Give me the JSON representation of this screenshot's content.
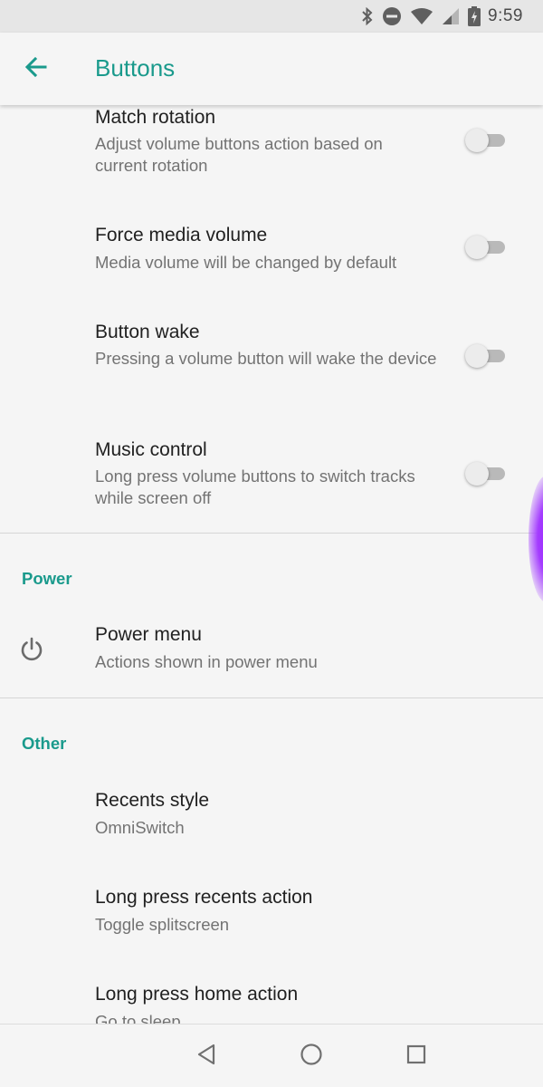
{
  "status_bar": {
    "time": "9:59",
    "icons": [
      "bluetooth-icon",
      "do-not-disturb-icon",
      "wifi-icon",
      "cell-signal-icon",
      "battery-charging-icon"
    ]
  },
  "app_bar": {
    "title": "Buttons",
    "back_icon": "arrow-back-icon"
  },
  "volume_settings": [
    {
      "title": "Match rotation",
      "summary": "Adjust volume buttons action based on current rotation",
      "enabled": false
    },
    {
      "title": "Force media volume",
      "summary": "Media volume will be changed by default",
      "enabled": false
    },
    {
      "title": "Button wake",
      "summary": "Pressing a volume button will wake the device",
      "enabled": false
    },
    {
      "title": "Music control",
      "summary": "Long press volume buttons to switch tracks while screen off",
      "enabled": false
    }
  ],
  "power_section": {
    "header": "Power",
    "item": {
      "title": "Power menu",
      "summary": "Actions shown in power menu",
      "icon": "power-icon"
    }
  },
  "other_section": {
    "header": "Other",
    "items": [
      {
        "title": "Recents style",
        "summary": "OmniSwitch"
      },
      {
        "title": "Long press recents action",
        "summary": "Toggle splitscreen"
      },
      {
        "title": "Long press home action",
        "summary": "Go to sleep"
      }
    ]
  },
  "nav_bar": {
    "buttons": [
      "back-triangle-icon",
      "home-circle-icon",
      "recents-square-icon"
    ]
  },
  "colors": {
    "accent": "#1a9a8c",
    "edge_glow": "#9a1fff"
  }
}
